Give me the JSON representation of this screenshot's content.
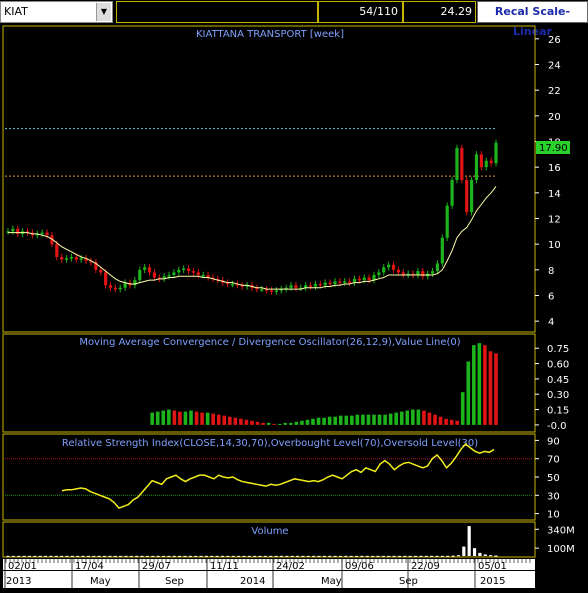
{
  "toolbar": {
    "symbol": "KIAT",
    "count": "54/110",
    "last_price": "24.29",
    "recal_button": "Recal Scale-Linear"
  },
  "chart_data": [
    {
      "type": "candlestick",
      "title": "KIATTANA TRANSPORT [week]",
      "ylim": [
        3,
        27
      ],
      "yticks": [
        4,
        6,
        8,
        10,
        12,
        14,
        16,
        18,
        20,
        22,
        24,
        26
      ],
      "last_value_label": "17.90",
      "reference_lines": [
        19,
        15.3
      ],
      "close": [
        11.0,
        11.2,
        10.8,
        11.0,
        10.9,
        10.7,
        10.8,
        10.9,
        10.7,
        10.0,
        9.0,
        8.8,
        8.9,
        9.0,
        8.8,
        8.9,
        8.7,
        8.6,
        8.0,
        7.8,
        6.8,
        6.6,
        6.5,
        6.6,
        7.0,
        6.8,
        7.2,
        8.0,
        8.2,
        7.8,
        7.4,
        7.3,
        7.5,
        7.6,
        7.8,
        8.0,
        8.1,
        7.9,
        7.8,
        7.6,
        7.6,
        7.4,
        7.3,
        7.2,
        7.0,
        6.9,
        6.9,
        6.8,
        6.7,
        6.8,
        6.6,
        6.5,
        6.5,
        6.4,
        6.3,
        6.4,
        6.5,
        6.6,
        6.8,
        6.6,
        6.6,
        6.8,
        6.7,
        6.9,
        6.8,
        7.0,
        6.9,
        7.1,
        7.0,
        7.1,
        7.0,
        7.3,
        7.2,
        7.4,
        7.2,
        7.6,
        7.8,
        8.2,
        8.4,
        8.0,
        7.8,
        7.6,
        7.7,
        7.6,
        7.9,
        7.5,
        7.7,
        7.9,
        8.5,
        10.5,
        13.0,
        15.0,
        17.5,
        15.0,
        12.5,
        15.0,
        17.0,
        16.0,
        16.5,
        16.3,
        17.9
      ],
      "ma_line": [
        10.9,
        10.9,
        10.9,
        10.9,
        10.9,
        10.8,
        10.8,
        10.7,
        10.6,
        10.4,
        10.1,
        9.8,
        9.6,
        9.4,
        9.2,
        9.0,
        8.9,
        8.7,
        8.5,
        8.2,
        7.9,
        7.6,
        7.3,
        7.1,
        7.0,
        6.9,
        6.9,
        7.0,
        7.1,
        7.2,
        7.2,
        7.3,
        7.3,
        7.4,
        7.4,
        7.5,
        7.5,
        7.5,
        7.5,
        7.5,
        7.4,
        7.4,
        7.3,
        7.2,
        7.1,
        7.0,
        7.0,
        6.9,
        6.8,
        6.8,
        6.7,
        6.6,
        6.6,
        6.5,
        6.5,
        6.5,
        6.5,
        6.5,
        6.5,
        6.5,
        6.5,
        6.6,
        6.6,
        6.6,
        6.6,
        6.7,
        6.7,
        6.8,
        6.8,
        6.9,
        6.9,
        7.0,
        7.0,
        7.1,
        7.1,
        7.2,
        7.3,
        7.4,
        7.6,
        7.6,
        7.6,
        7.6,
        7.6,
        7.6,
        7.6,
        7.6,
        7.6,
        7.6,
        7.7,
        8.0,
        8.7,
        9.5,
        10.5,
        11.0,
        11.3,
        11.9,
        12.6,
        13.1,
        13.6,
        14.0,
        14.5
      ]
    },
    {
      "type": "bar",
      "title": "Moving Average Convergence / Divergence Oscillator(26,12,9),Value Line(0)",
      "ylim": [
        -0.05,
        0.85
      ],
      "yticks": [
        -0.0,
        0.15,
        0.3,
        0.45,
        0.6,
        0.75
      ],
      "ytick_labels": [
        "-0.0",
        "0.15",
        "0.30",
        "0.45",
        "0.60",
        "0.75"
      ],
      "values": [
        0,
        0,
        0,
        0,
        0,
        0,
        0,
        0,
        0,
        0,
        0,
        0,
        0,
        0,
        0,
        0,
        0,
        0,
        0,
        0,
        0,
        0,
        0,
        0,
        0,
        0,
        0.12,
        0.13,
        0.14,
        0.15,
        0.14,
        0.13,
        0.13,
        0.14,
        0.13,
        0.12,
        0.12,
        0.11,
        0.1,
        0.09,
        0.08,
        0.07,
        0.06,
        0.05,
        0.04,
        0.03,
        0.02,
        0.02,
        0.01,
        0.01,
        0.02,
        0.02,
        0.03,
        0.04,
        0.05,
        0.06,
        0.07,
        0.07,
        0.08,
        0.08,
        0.09,
        0.09,
        0.09,
        0.1,
        0.1,
        0.1,
        0.1,
        0.1,
        0.1,
        0.11,
        0.12,
        0.13,
        0.14,
        0.15,
        0.15,
        0.14,
        0.12,
        0.1,
        0.08,
        0.06,
        0.05,
        0.04,
        0.32,
        0.62,
        0.78,
        0.8,
        0.78,
        0.72,
        0.7
      ]
    },
    {
      "type": "line",
      "title": "Relative Strength Index(CLOSE,14,30,70),Overbought Level(70),Oversold Level(30)",
      "ylim": [
        3,
        97
      ],
      "yticks": [
        10,
        30,
        50,
        70,
        90
      ],
      "reference_lines": [
        70,
        30
      ],
      "values": [
        35,
        36,
        36,
        37,
        38,
        37,
        34,
        32,
        30,
        28,
        26,
        22,
        16,
        18,
        20,
        25,
        28,
        34,
        40,
        46,
        44,
        42,
        48,
        50,
        52,
        48,
        45,
        48,
        50,
        52,
        52,
        50,
        48,
        52,
        50,
        49,
        50,
        47,
        45,
        44,
        43,
        42,
        41,
        40,
        42,
        41,
        42,
        44,
        46,
        48,
        47,
        46,
        45,
        46,
        45,
        47,
        50,
        52,
        50,
        48,
        52,
        56,
        58,
        55,
        60,
        58,
        56,
        64,
        68,
        64,
        58,
        62,
        65,
        66,
        64,
        62,
        60,
        62,
        70,
        74,
        68,
        60,
        65,
        72,
        80,
        86,
        82,
        78,
        76,
        78,
        77,
        80
      ]
    },
    {
      "type": "bar",
      "title": "Volume",
      "ylim": [
        0,
        420
      ],
      "yticks": [
        100,
        340
      ],
      "ytick_labels": [
        "100M",
        "340M"
      ],
      "values": [
        2,
        2,
        2,
        2,
        2,
        2,
        2,
        2,
        2,
        2,
        2,
        2,
        2,
        2,
        2,
        2,
        2,
        2,
        2,
        2,
        2,
        2,
        2,
        2,
        2,
        2,
        2,
        2,
        2,
        2,
        2,
        2,
        2,
        2,
        2,
        2,
        2,
        2,
        2,
        2,
        2,
        2,
        2,
        2,
        2,
        2,
        2,
        2,
        2,
        2,
        2,
        2,
        2,
        2,
        2,
        2,
        2,
        2,
        2,
        2,
        2,
        2,
        2,
        2,
        2,
        2,
        2,
        2,
        2,
        2,
        2,
        2,
        2,
        2,
        2,
        2,
        2,
        2,
        2,
        2,
        2,
        2,
        2,
        5,
        10,
        120,
        380,
        100,
        40,
        20,
        10,
        6
      ]
    },
    {
      "type": "axis",
      "date_labels": [
        "02/01",
        "17/04",
        "29/07",
        "11/11",
        "24/02",
        "09/06",
        "22/09",
        "05/01"
      ],
      "month_labels": [
        "2013",
        "May",
        "Sep",
        "2014",
        "May",
        "Sep",
        "2015"
      ]
    }
  ],
  "colors": {
    "up": "#1db31d",
    "down": "#e01414",
    "ma": "#ffffaa",
    "rsi_line": "#f2ee1c",
    "panel_border": "#c8b400",
    "title": "#7fa0ff",
    "last_value_bg": "#2ad12a"
  }
}
